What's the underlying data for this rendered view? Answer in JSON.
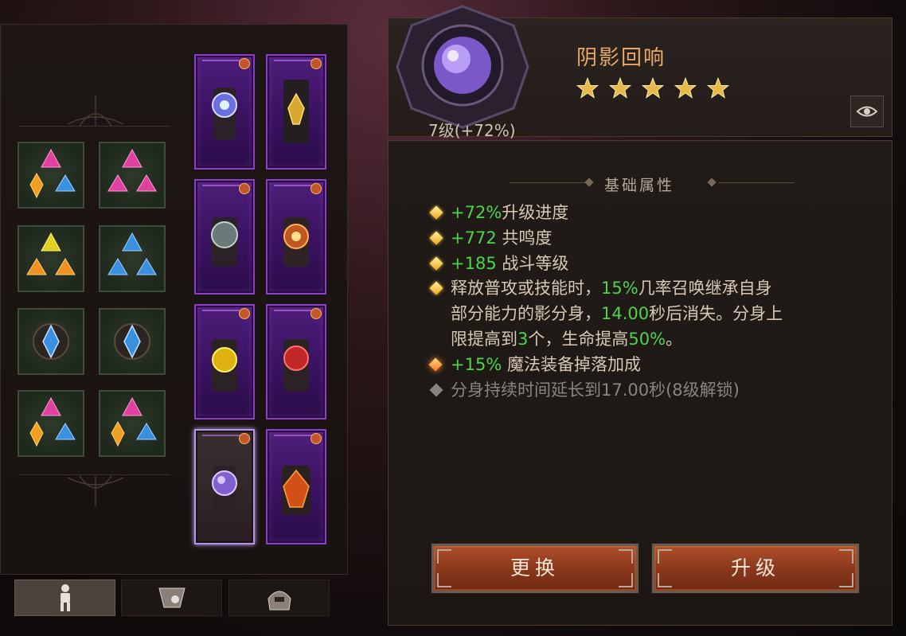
{
  "item": {
    "name": "阴影回响",
    "stars": 5,
    "level_text": "7级(+72%)"
  },
  "details": {
    "section_title": "基础属性",
    "attributes": [
      {
        "prefix": "+72%",
        "text": "升级进度",
        "bullet": "gold"
      },
      {
        "prefix": "+772",
        "text": " 共鸣度",
        "bullet": "gold"
      },
      {
        "prefix": "+185",
        "text": " 战斗等级",
        "bullet": "gold"
      }
    ],
    "effect": {
      "line1_a": "释放普攻或技能时，",
      "line1_pct": "15%",
      "line1_b": "几率召唤继承自身",
      "line2_a": "部分能力的影分身，",
      "line2_num": "14.00",
      "line2_b": "秒后消失。分身上",
      "line3_a": "限提高到",
      "line3_num": "3",
      "line3_b": "个，生命提高",
      "line3_pct": "50%",
      "line3_c": "。"
    },
    "bonus": {
      "prefix": "+15%",
      "text": " 魔法装备掉落加成"
    },
    "locked": {
      "text": "分身持续时间延长到17.00秒(8级解锁)"
    }
  },
  "buttons": {
    "replace": "更换",
    "upgrade": "升级"
  },
  "tabs": [
    {
      "name": "character-tab",
      "active": true
    },
    {
      "name": "equipment-tab",
      "active": false
    },
    {
      "name": "helmet-tab",
      "active": false
    }
  ],
  "colors": {
    "title": "#e8a868",
    "highlight": "#4dd44a",
    "card_border": "#8a3fc9",
    "button": "#9a4222"
  }
}
